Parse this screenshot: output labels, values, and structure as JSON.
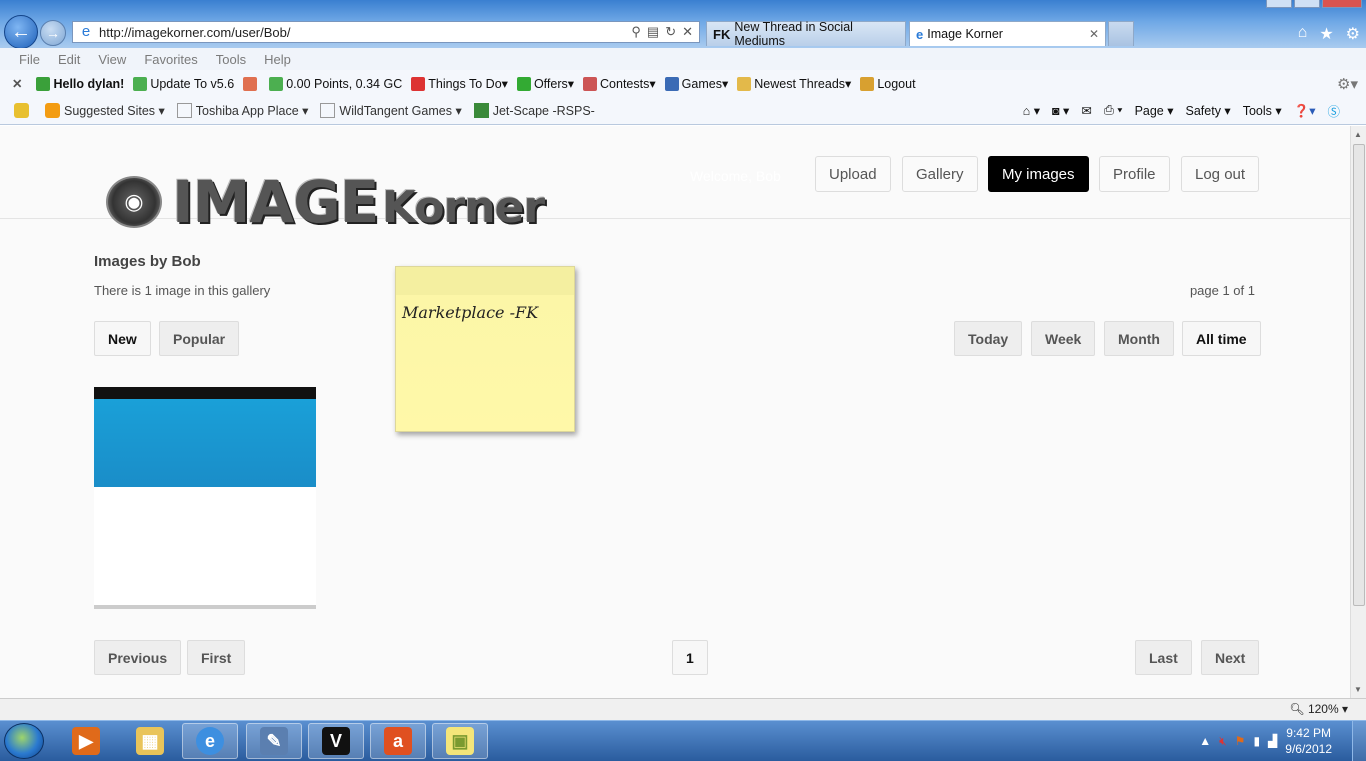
{
  "browser": {
    "url": "http://imagekorner.com/user/Bob/",
    "tabs": [
      {
        "label": "New Thread in Social Mediums",
        "favicon": "FK"
      },
      {
        "label": "Image Korner"
      }
    ],
    "menu": [
      "File",
      "Edit",
      "View",
      "Favorites",
      "Tools",
      "Help"
    ],
    "command_bar": {
      "hello": "Hello dylan!",
      "update": "Update To v5.6",
      "points": "0.00 Points, 0.34 GC",
      "things": "Things To Do",
      "offers": "Offers",
      "contests": "Contests",
      "games": "Games",
      "newest": "Newest Threads",
      "logout": "Logout"
    },
    "favorites": {
      "suggested": "Suggested Sites",
      "toshiba": "Toshiba App Place",
      "wildtangent": "WildTangent Games",
      "jetscape": "Jet-Scape -RSPS-"
    },
    "ie_tools": {
      "page": "Page",
      "safety": "Safety",
      "tools": "Tools"
    },
    "zoom": "120%"
  },
  "site": {
    "logo_big": "IMAGE",
    "logo_small": "Korner",
    "welcome": "Welcome, Bob",
    "nav": {
      "upload": "Upload",
      "gallery": "Gallery",
      "my_images": "My images",
      "profile": "Profile",
      "logout": "Log out"
    },
    "gallery": {
      "title": "Images by Bob",
      "count": "There is 1 image in this gallery",
      "page_info": "page 1 of 1",
      "sort": {
        "new": "New",
        "popular": "Popular"
      },
      "range": {
        "today": "Today",
        "week": "Week",
        "month": "Month",
        "all": "All time"
      },
      "pagination": {
        "previous": "Previous",
        "first": "First",
        "page": "1",
        "last": "Last",
        "next": "Next"
      }
    },
    "sticky_note": "Marketplace -FK"
  },
  "taskbar": {
    "time": "9:42 PM",
    "date": "9/6/2012"
  },
  "colors": {
    "active_nav": "#000000",
    "thumb_blue": "#1aa0d8",
    "sticky": "#fff8a8",
    "taskbar": "#2a5c9e"
  }
}
